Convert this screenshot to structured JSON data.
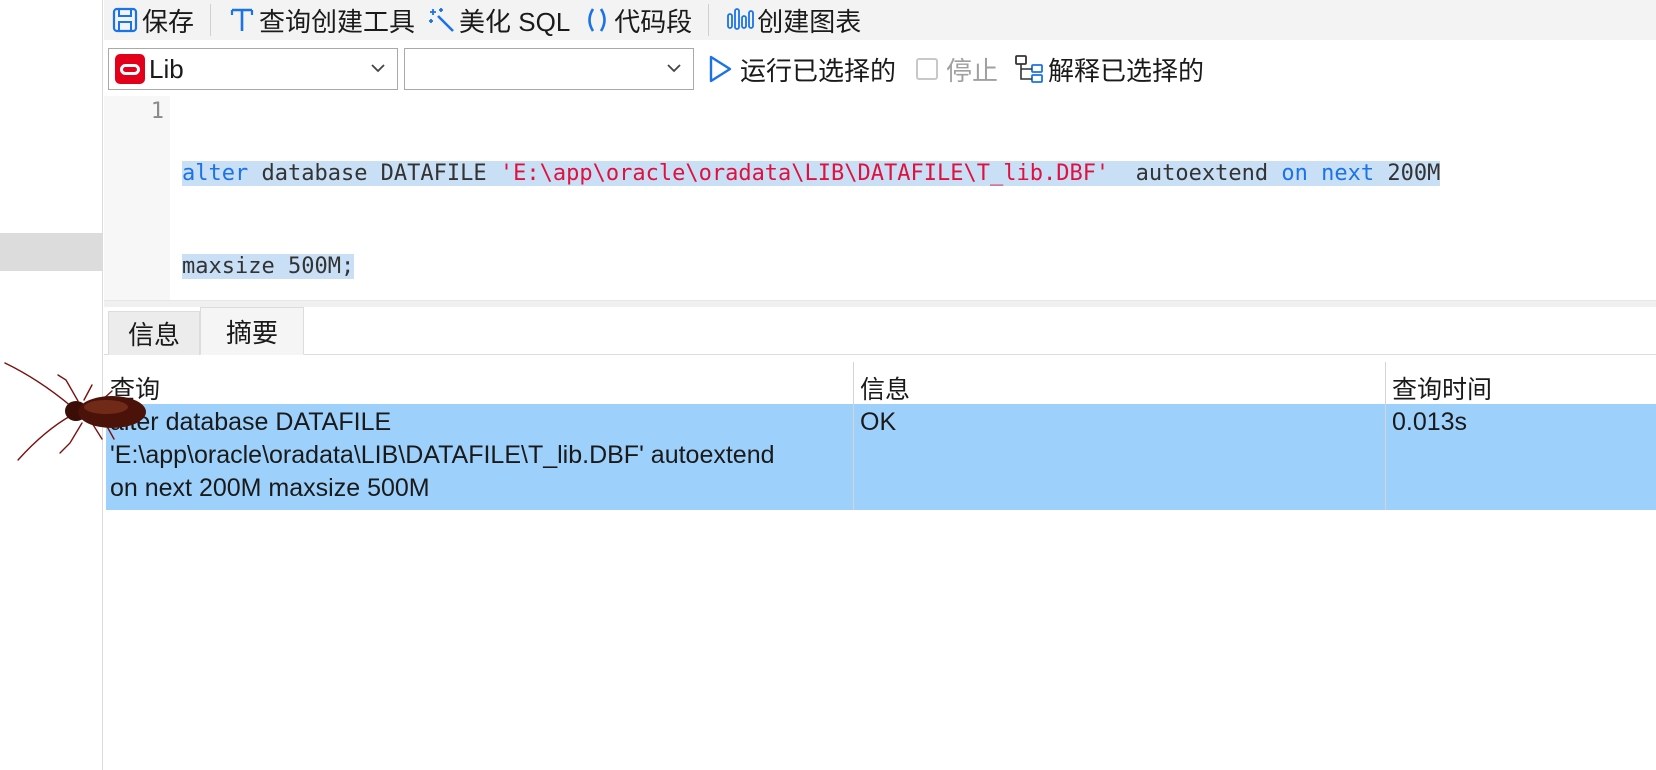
{
  "toolbar": {
    "save": "保存",
    "query_builder": "查询创建工具",
    "beautify": "美化 SQL",
    "snippet": "代码段",
    "create_chart": "创建图表"
  },
  "connection": {
    "database": "Lib",
    "schema": "",
    "run_selected": "运行已选择的",
    "stop": "停止",
    "explain_selected": "解释已选择的"
  },
  "editor": {
    "line_number": "1",
    "line1": {
      "t1": "alter",
      "t2": " database DATAFILE ",
      "t3": "'E:\\app\\oracle\\oradata\\LIB\\DATAFILE\\T_lib.DBF'",
      "t4": "  autoextend ",
      "t5": "on",
      "t6": " ",
      "t7": "next",
      "t8": " 200M"
    },
    "line2": "maxsize 500M;"
  },
  "result_tabs": [
    "信息",
    "摘要"
  ],
  "grid": {
    "headers": [
      "查询",
      "信息",
      "查询时间"
    ],
    "row": {
      "query_lines": [
        "alter database DATAFILE",
        "'E:\\app\\oracle\\oradata\\LIB\\DATAFILE\\T_lib.DBF'  autoextend",
        "on next 200M maxsize 500M"
      ],
      "message": "OK",
      "time": "0.013s"
    }
  },
  "colors": {
    "keyword": "#1a73e8",
    "string": "#e0103f",
    "selection": "#c9dff5",
    "row_highlight": "#9dd0fb",
    "oracle_red": "#e3001b"
  }
}
